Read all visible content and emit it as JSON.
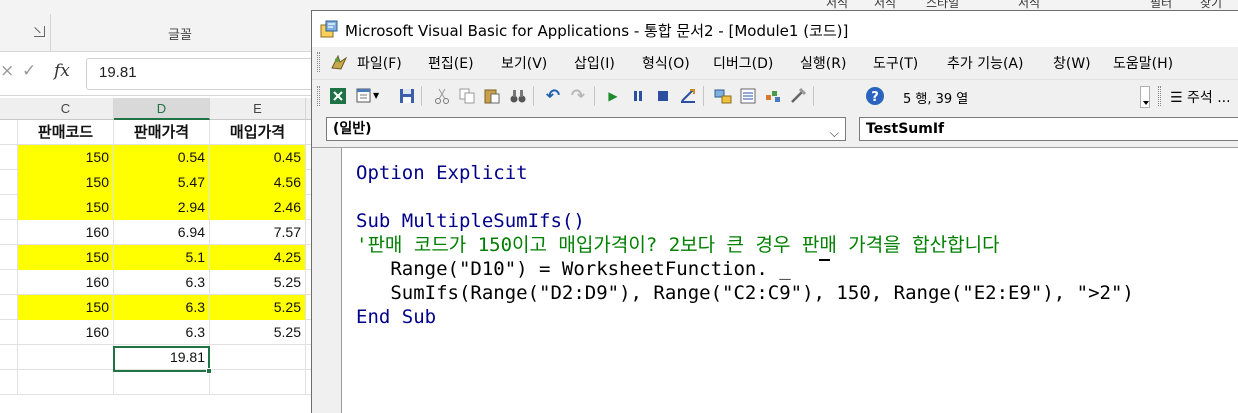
{
  "excel": {
    "ribbon_fragments": [
      "서식 ˅",
      "서식 ˅",
      "스타일 ˅",
      "서식 ˅",
      "필터 ˅",
      "찾기 ˅"
    ],
    "font_group_label": "글꼴",
    "formula_bar": {
      "cancel_glyph": "×",
      "enter_glyph": "✓",
      "fx_glyph": "fx",
      "value": "19.81"
    },
    "column_headers": [
      "C",
      "D",
      "E"
    ],
    "selected_column": "D",
    "header_row": [
      "판매코드",
      "판매가격",
      "매입가격"
    ],
    "rows": [
      {
        "c": "150",
        "d": "0.54",
        "e": "0.45",
        "highlight": true
      },
      {
        "c": "150",
        "d": "5.47",
        "e": "4.56",
        "highlight": true
      },
      {
        "c": "150",
        "d": "2.94",
        "e": "2.46",
        "highlight": true
      },
      {
        "c": "160",
        "d": "6.94",
        "e": "7.57",
        "highlight": false
      },
      {
        "c": "150",
        "d": "5.1",
        "e": "4.25",
        "highlight": true
      },
      {
        "c": "160",
        "d": "6.3",
        "e": "5.25",
        "highlight": false
      },
      {
        "c": "150",
        "d": "6.3",
        "e": "5.25",
        "highlight": true
      },
      {
        "c": "160",
        "d": "6.3",
        "e": "5.25",
        "highlight": false
      }
    ],
    "result_cell": "19.81",
    "highlight_color": "#ffff00",
    "selection_color": "#217346"
  },
  "vba": {
    "title": "Microsoft Visual Basic for Applications - 통합 문서2 - [Module1 (코드)]",
    "menu": [
      "파일(F)",
      "편집(E)",
      "보기(V)",
      "삽입(I)",
      "형식(O)",
      "디버그(D)",
      "실행(R)",
      "도구(T)",
      "추가 기능(A)",
      "창(W)",
      "도움말(H)"
    ],
    "toolbar": {
      "icons": [
        "excel-icon",
        "insert-module-icon",
        "save-icon",
        "cut-icon",
        "copy-icon",
        "paste-icon",
        "find-icon",
        "undo-icon",
        "redo-icon",
        "run-icon",
        "break-icon",
        "reset-icon",
        "design-mode-icon",
        "project-explorer-icon",
        "properties-icon",
        "object-browser-icon",
        "toolbox-icon",
        "help-icon"
      ],
      "position": "5 행, 39 열",
      "comment_label": "주석 ..."
    },
    "object_combo": "(일반)",
    "procedure_combo": "TestSumIf",
    "code": {
      "line1": "Option Explicit",
      "line2": "Sub MultipleSumIfs()",
      "line3": "'판매 코드가 150이고 매입가격이? 2보다 큰 경우 판매 가격을 합산합니다",
      "line4": "   Range(\"D10\") = WorksheetFunction. _",
      "line5": "   SumIfs(Range(\"D2:D9\"), Range(\"C2:C9\"), 150, Range(\"E2:E9\"), \">2\")",
      "line6": "End Sub"
    },
    "keyword_color": "#00008b",
    "comment_color": "#008000"
  }
}
